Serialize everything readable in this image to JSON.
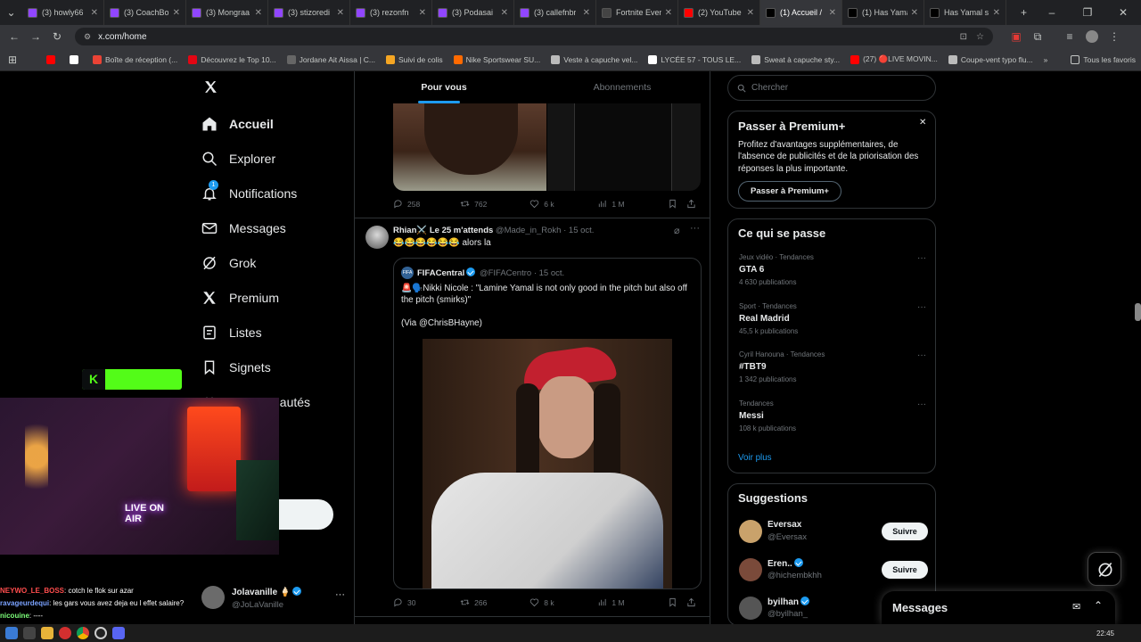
{
  "browser": {
    "tabs": [
      {
        "label": "(3) howly66",
        "color": "#9146ff"
      },
      {
        "label": "(3) CoachBo",
        "color": "#9146ff"
      },
      {
        "label": "(3) Mongraa",
        "color": "#9146ff"
      },
      {
        "label": "(3) stizoredi",
        "color": "#9146ff"
      },
      {
        "label": "(3) rezonfn",
        "color": "#9146ff"
      },
      {
        "label": "(3) Podasai",
        "color": "#9146ff"
      },
      {
        "label": "(3) callefnbr",
        "color": "#9146ff"
      },
      {
        "label": "Fortnite Even",
        "color": "#444444"
      },
      {
        "label": "(2) YouTube",
        "color": "#ff0000"
      },
      {
        "label": "(1) Accueil /",
        "color": "#000000"
      },
      {
        "label": "(1) Has Yama",
        "color": "#000000"
      },
      {
        "label": "Has Yamal s",
        "color": "#000000"
      }
    ],
    "active_tab_index": 9,
    "url": "x.com/home",
    "bookmarks": [
      {
        "label": "",
        "color": "#ff0000"
      },
      {
        "label": "",
        "color": "#ffffff"
      },
      {
        "label": "Boîte de réception (...",
        "color": "#ea4335"
      },
      {
        "label": "Découvrez le Top 10...",
        "color": "#e30613"
      },
      {
        "label": "Jordane Ait Aissa | C...",
        "color": "#666666"
      },
      {
        "label": "Suivi de colis",
        "color": "#f5a623"
      },
      {
        "label": "Nike Sportswear SU...",
        "color": "#ff6a00"
      },
      {
        "label": "Veste à capuche vel...",
        "color": "#bbbbbb"
      },
      {
        "label": "LYCÉE 57 - TOUS LE...",
        "color": "#ffffff"
      },
      {
        "label": "Sweat à capuche sty...",
        "color": "#bbbbbb"
      },
      {
        "label": "(27) 🔴LIVE MOVIN...",
        "color": "#ff0000"
      },
      {
        "label": "Coupe-vent typo flu...",
        "color": "#bbbbbb"
      }
    ],
    "all_bookmarks": "Tous les favoris"
  },
  "nav": {
    "items": [
      "Accueil",
      "Explorer",
      "Notifications",
      "Messages",
      "Grok",
      "Premium",
      "Listes",
      "Signets",
      "Communautés"
    ],
    "notif_badge": "1",
    "profile_name": "Jolavanille 🍦",
    "profile_handle": "@JoLaVanille"
  },
  "feed": {
    "tab_foryou": "Pour vous",
    "tab_following": "Abonnements",
    "tweet1_actions": {
      "replies": "258",
      "retweets": "762",
      "likes": "6 k",
      "views": "1 M"
    },
    "tweet2": {
      "author": "Rhian⚔️ Le 25 m'attends",
      "handle": "@Made_in_Rokh",
      "date": "· 15 oct.",
      "text": "😂😂😂😂😂😂 alors la",
      "quote": {
        "author": "FIFACentral",
        "handle": "@FIFACentro",
        "date": "· 15 oct.",
        "text": "🚨🗣️Nikki Nicole : \"Lamine Yamal is not only good in the pitch but also off the pitch (smirks)\"",
        "via": "(Via @ChrisBHayne)"
      },
      "actions": {
        "replies": "30",
        "retweets": "266",
        "likes": "8 k",
        "views": "1 M"
      }
    }
  },
  "right": {
    "search_placeholder": "Chercher",
    "premium_title": "Passer à Premium+",
    "premium_text": "Profitez d'avantages supplémentaires, de l'absence de publicités et de la priorisation des réponses la plus importante.",
    "premium_button": "Passer à Premium+",
    "trends_title": "Ce qui se passe",
    "trends": [
      {
        "meta": "Jeux vidéo · Tendances",
        "name": "GTA 6",
        "count": "4 630 publications"
      },
      {
        "meta": "Sport · Tendances",
        "name": "Real Madrid",
        "count": "45,5 k publications"
      },
      {
        "meta": "Cyril Hanouna · Tendances",
        "name": "#TBT9",
        "count": "1 342 publications"
      },
      {
        "meta": "Tendances",
        "name": "Messi",
        "count": "108 k publications"
      }
    ],
    "show_more": "Voir plus",
    "suggestions_title": "Suggestions",
    "suggestions": [
      {
        "name": "Eversax",
        "handle": "@Eversax",
        "verified": false,
        "button": "Suivre"
      },
      {
        "name": "Eren..",
        "handle": "@hichembkhh",
        "verified": true,
        "button": "Suivre"
      },
      {
        "name": "byilhan",
        "handle": "@byilhan_",
        "verified": true,
        "button": ""
      }
    ],
    "messages_drawer": "Messages"
  },
  "stream": {
    "live_sign": "LIVE ON AIR",
    "chat": [
      {
        "user": "NEYWO_LE_BOSS",
        "color": "#ff4d4d",
        "msg": ": cotch le flok sur azar"
      },
      {
        "user": "ravageurdequi",
        "color": "#7aa2ff",
        "msg": ": les gars vous avez deja eu l effet salaire?"
      },
      {
        "user": "nicouine",
        "color": "#7dff7a",
        "msg": ": ----"
      }
    ]
  },
  "taskbar": {
    "time": "22:45"
  },
  "colors": {
    "accent": "#1d9bf0",
    "bg": "#000000",
    "border": "#2f3336",
    "muted": "#71767b"
  }
}
